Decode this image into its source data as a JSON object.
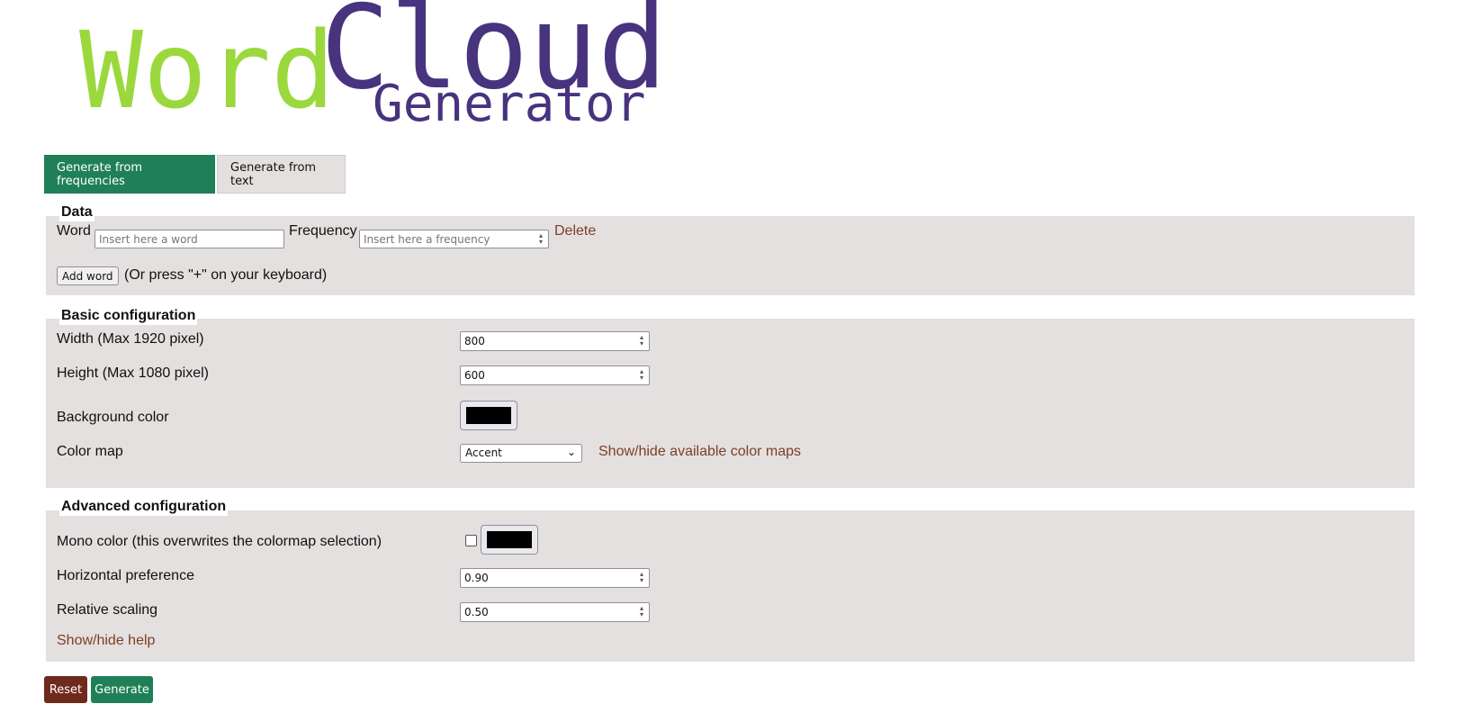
{
  "logo": {
    "word": "Word",
    "cloud": "Cloud",
    "generator": "Generator"
  },
  "tabs": [
    {
      "label": "Generate from frequencies",
      "active": true
    },
    {
      "label": "Generate from text",
      "active": false
    }
  ],
  "data_section": {
    "legend": "Data",
    "word_label": "Word",
    "word_placeholder": "Insert here a word",
    "frequency_label": "Frequency",
    "frequency_placeholder": "Insert here a frequency",
    "delete_label": "Delete",
    "add_word_label": "Add word",
    "add_word_hint": "(Or press \"+\" on your keyboard)"
  },
  "basic": {
    "legend": "Basic configuration",
    "width_label": "Width (Max 1920 pixel)",
    "width_value": "800",
    "height_label": "Height (Max 1080 pixel)",
    "height_value": "600",
    "bg_label": "Background color",
    "bg_color": "#000000",
    "colormap_label": "Color map",
    "colormap_value": "Accent",
    "colormap_link": "Show/hide available color maps"
  },
  "advanced": {
    "legend": "Advanced configuration",
    "mono_label": "Mono color (this overwrites the colormap selection)",
    "mono_checked": false,
    "mono_color": "#000000",
    "horizontal_label": "Horizontal preference",
    "horizontal_value": "0.90",
    "relative_label": "Relative scaling",
    "relative_value": "0.50",
    "help_link": "Show/hide help"
  },
  "actions": {
    "reset_label": "Reset",
    "generate_label": "Generate"
  },
  "colors": {
    "primary": "#1f8058",
    "danger": "#6e2a1c",
    "link": "#7b3f26",
    "logo_green": "#9bd83d",
    "logo_purple": "#48337f"
  }
}
